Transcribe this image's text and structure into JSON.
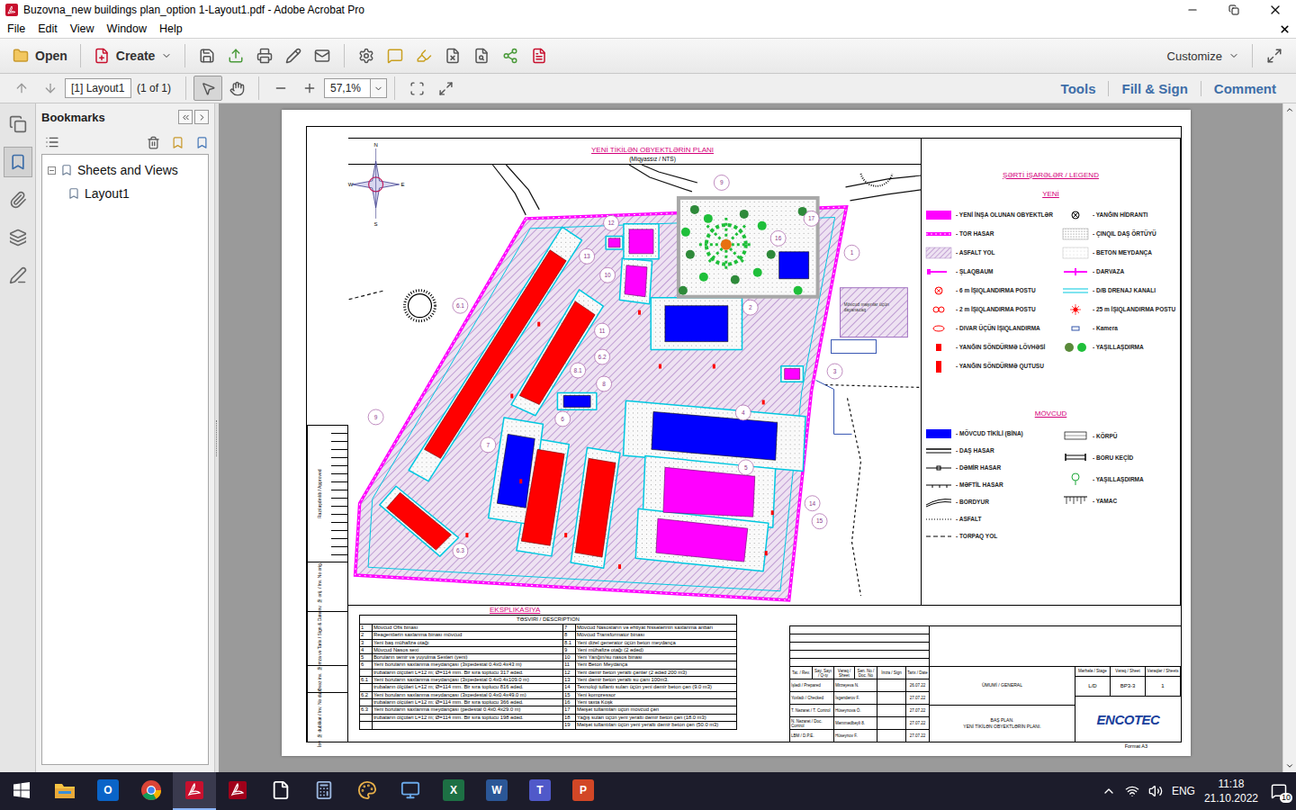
{
  "window": {
    "title": "Buzovna_new buildings plan_option 1-Layout1.pdf - Adobe Acrobat Pro"
  },
  "menu": [
    {
      "label": "File"
    },
    {
      "label": "Edit"
    },
    {
      "label": "View"
    },
    {
      "label": "Window"
    },
    {
      "label": "Help"
    }
  ],
  "toolbar": {
    "open": "Open",
    "create": "Create",
    "customize": "Customize"
  },
  "navigation": {
    "page": "[1] Layout1",
    "count": "(1 of 1)",
    "zoom": "57,1%"
  },
  "tools": [
    {
      "kind": "select",
      "selected": true
    },
    {
      "kind": "hand",
      "selected": false
    }
  ],
  "panels": [
    {
      "label": "Tools"
    },
    {
      "label": "Fill & Sign"
    },
    {
      "label": "Comment"
    }
  ],
  "sidestrip": [
    {
      "kind": "pages",
      "selected": false
    },
    {
      "kind": "bookmarks",
      "selected": true
    },
    {
      "kind": "attachments",
      "selected": false
    },
    {
      "kind": "layers",
      "selected": false
    },
    {
      "kind": "signatures",
      "selected": false
    }
  ],
  "bookmarks": {
    "title": "Bookmarks",
    "items": [
      {
        "label": "Sheets and Views",
        "level": 0,
        "expanded": true,
        "selected": false
      },
      {
        "label": "Layout1",
        "level": 1,
        "expanded": false,
        "selected": false
      }
    ]
  },
  "sheet": {
    "title": "YENİ TİKİLƏN OBYEKTLƏRİN PLANI",
    "scale": "(Miqyassız / NTS)",
    "compass": {
      "n": "N",
      "s": "S",
      "e": "E",
      "w": "W"
    },
    "labels": [
      "1",
      "2",
      "3",
      "4",
      "5",
      "6",
      "6.1",
      "6.2",
      "6.3",
      "7",
      "8",
      "8.1",
      "9",
      "9",
      "10",
      "11",
      "12",
      "13",
      "14",
      "15",
      "16",
      "17"
    ],
    "parking": "Mövcud maşınlar üçün dayanacaq",
    "stamps": [
      "Razılaşdırılıb / Approved",
      "İnv. № orij. / Inv. No orig.",
      "İmza və Tarix / Sign & Date",
      "Əvəz inv. №",
      "İnv. № dublikat / Inv. No dupl."
    ],
    "format": "Format A3"
  },
  "legend": {
    "title": "ŞƏRTİ İŞARƏLƏR / LEGEND",
    "newTitle": "YENİ",
    "existingTitle": "MÖVCUD",
    "newLeft": [
      {
        "label": "- YENİ İNŞA OLUNAN OBYEKTLƏR",
        "kind": "fill",
        "color": "#ff00ff"
      },
      {
        "label": "- TOR HASAR",
        "kind": "fence"
      },
      {
        "label": "- ASFALT YOL",
        "kind": "hatch"
      },
      {
        "label": "- ŞLAQBAUM",
        "kind": "barrier"
      },
      {
        "label": "- 6 m İŞIQLANDIRMA POSTU",
        "kind": "light6"
      },
      {
        "label": "- 2 m İŞIQLANDIRMA POSTU",
        "kind": "light2"
      },
      {
        "label": "- DIVAR ÜÇÜN İŞIQLANDIRMA",
        "kind": "walllight"
      },
      {
        "label": "- YANĞIN SÖNDÜRMƏ LÖVHƏSİ",
        "kind": "board"
      },
      {
        "label": "- YANĞIN SÖNDÜRMƏ QUTUSU",
        "kind": "box"
      }
    ],
    "newRight": [
      {
        "label": "- YANĞIN HİDRANTI",
        "kind": "hydrant"
      },
      {
        "label": "- ÇINQIL DAŞ ÖRTÜYÜ",
        "kind": "gravel"
      },
      {
        "label": "- BETON MEYDANÇA",
        "kind": "concrete"
      },
      {
        "label": "- DARVAZA",
        "kind": "gate"
      },
      {
        "label": "- D/B DRENAJ KANALI",
        "kind": "drain"
      },
      {
        "label": "- 25 m İŞIQLANDIRMA POSTU",
        "kind": "light25"
      },
      {
        "label": "- Kamera",
        "kind": "camera"
      },
      {
        "label": "- YAŞILLAŞDIRMA",
        "kind": "greenery"
      }
    ],
    "existingLeft": [
      {
        "label": "- MÖVCUD TİKİLİ (BİNA)",
        "kind": "fill",
        "color": "#0000ff"
      },
      {
        "label": "- DAŞ HASAR",
        "kind": "stonefence"
      },
      {
        "label": "- DƏMİR HASAR",
        "kind": "ironfence"
      },
      {
        "label": "- MƏFTİL HASAR",
        "kind": "wirefence"
      },
      {
        "label": "- BORDYUR",
        "kind": "curb"
      },
      {
        "label": "- ASFALT",
        "kind": "asphalt"
      },
      {
        "label": "- TORPAQ YOL",
        "kind": "dirtroad"
      }
    ],
    "existingRight": [
      {
        "label": "- KÖRPÜ",
        "kind": "bridge"
      },
      {
        "label": "- BORU KEÇİD",
        "kind": "pipe"
      },
      {
        "label": "- YAŞILLAŞDIRMA",
        "kind": "tree"
      },
      {
        "label": "- YAMAC",
        "kind": "slope"
      }
    ]
  },
  "explication": {
    "title": "EKSPLİKASIYA",
    "header": "TƏSVİRİ / DESCRIPTION",
    "rows": [
      {
        "leftNum": "1",
        "leftText": "Mövcud Ofis binası",
        "rightNum": "7",
        "rightText": "Mövcud Nasosların və ehtiyat hissələrinin saxlanma anbarı"
      },
      {
        "leftNum": "2",
        "leftText": "Reagentlərin saxlanma binası mövcud",
        "rightNum": "8",
        "rightText": "Mövcud Transformator binası"
      },
      {
        "leftNum": "3",
        "leftText": "Yeni baş mühafizə otağı",
        "rightNum": "8.1",
        "rightText": "Yeni dizel generator üçün beton meydança"
      },
      {
        "leftNum": "4",
        "leftText": "Mövcud Nasos sexi",
        "rightNum": "9",
        "rightText": "Yeni mühafizə otağı (2 ədəd)"
      },
      {
        "leftNum": "5",
        "leftText": "Boruların təmir və yuyulma Sexləri (yeni)",
        "rightNum": "10",
        "rightText": "Yeni Yanğın/su nasos binası"
      },
      {
        "leftNum": "6",
        "leftText": "Yeni boruların saxlanma meydançası (3xpedestal 0.4x0.4x43 m)",
        "rightNum": "11",
        "rightText": "Yeni  Beton Meydança"
      },
      {
        "leftNum": "",
        "leftText": "trubaların ölçüləri L=12 m; Ø=114 mm. Bir sıra topluсu 317 ədəd.",
        "rightNum": "12",
        "rightText": "Yeni dəmir beton yeraltı çənlər  (2 ədəd 200 m3)"
      },
      {
        "leftNum": "6.1",
        "leftText": "Yeni boruların saxlanma meydançası (3xpedestal 0.4x0.4x109.0 m)",
        "rightNum": "13",
        "rightText": "Yeni dəmir beton yeraltı su çanı  100m3."
      },
      {
        "leftNum": "",
        "leftText": "trubaların ölçüləri L=12 m; Ø=114 mm. Bir sıra topluсu 816 ədəd.",
        "rightNum": "14",
        "rightText": "Texnoloji tullantı suları üçün yeni dəmir beton çən (9.0 m3)"
      },
      {
        "leftNum": "6.2",
        "leftText": "Yeni boruların saxlanma meydançası (3xpedestal 0.4x0.4x49.0 m)",
        "rightNum": "15",
        "rightText": "Yeni kompressor"
      },
      {
        "leftNum": "",
        "leftText": "trubaların ölçüləri L=12 m; Ø=114 mm. Bir sıra topluсu 366 ədəd.",
        "rightNum": "16",
        "rightText": "Yeni taxta Köşk"
      },
      {
        "leftNum": "6.3",
        "leftText": "Yeni boruların saxlanma meydançası (pedestal 0.4x0.4x29.0 m)",
        "rightNum": "17",
        "rightText": "Məişət tullantıları üçün mövcud çən"
      },
      {
        "leftNum": "",
        "leftText": "trubaların ölçüləri L=12 m; Ø=114 mm. Bir sıra topluсu 198 ədəd.",
        "rightNum": "18",
        "rightText": "Yağış suları üçün yeni yeraltı dəmir beton çən (18.0 m3)"
      },
      {
        "leftNum": "",
        "leftText": "",
        "rightNum": "19",
        "rightText": "Məişət tullantıları üçün yeni yeraltı dəmir beton çən  (50.0 m3)"
      }
    ]
  },
  "titleBlock": {
    "headers": [
      "Tat. / Rev.",
      "Say. Sayı / Q-ty",
      "Vərəq / Sheet",
      "Sən. No / Doc. No",
      "İmza / Sign",
      "Tarix / Date"
    ],
    "people": [
      {
        "role": "İşlədi / Prepared",
        "name": "Mirzəyeva N.",
        "date": "26.07.22"
      },
      {
        "role": "Yoxladı / Checked",
        "name": "İsgəndərov F.",
        "date": "27.07.22"
      },
      {
        "role": "T. Nəzarət / T. Control",
        "name": "Hüseynova Ö.",
        "date": "27.07.22"
      },
      {
        "role": "N. Nəzarət / Doc. Control",
        "name": "Məmmədbəyli 8.",
        "date": "27.07.22"
      },
      {
        "role": "LBM / D.P.E.",
        "name": "Hüseynov F.",
        "date": "27.07.22"
      }
    ],
    "section": "ÜMUMİ / GENERAL",
    "name1": "BAŞ PLAN.",
    "name2": "YENİ TİKİLƏN OBYEKTLƏRİN PLANI.",
    "stageHeaders": [
      "Mərhələ / Stage",
      "Vərəq / Sheet",
      "Vərəqlər / Sheets"
    ],
    "stageValues": [
      "L/D",
      "BP3-3",
      "1"
    ],
    "logo": "ENCOTEC"
  },
  "taskbar": {
    "apps": [
      {
        "kind": "explorer",
        "selected": false
      },
      {
        "kind": "outlook",
        "glyph": "O",
        "selected": false
      },
      {
        "kind": "chrome",
        "selected": false
      },
      {
        "kind": "acrobat",
        "selected": true
      },
      {
        "kind": "acrobat2",
        "selected": false
      },
      {
        "kind": "file",
        "selected": false
      },
      {
        "kind": "calculator",
        "selected": false
      },
      {
        "kind": "paint",
        "selected": false
      },
      {
        "kind": "monitor",
        "selected": false
      },
      {
        "kind": "excel",
        "glyph": "X",
        "selected": false
      },
      {
        "kind": "word",
        "glyph": "W",
        "selected": false
      },
      {
        "kind": "teams",
        "glyph": "T",
        "selected": false
      },
      {
        "kind": "powerpoint",
        "glyph": "P",
        "selected": false
      }
    ],
    "language": "ENG",
    "time": "11:18",
    "date": "21.10.2022",
    "notifications": "10"
  }
}
